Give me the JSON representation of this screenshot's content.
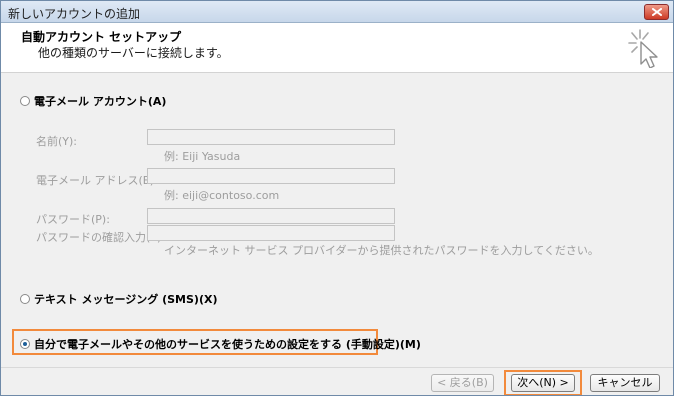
{
  "window": {
    "title": "新しいアカウントの追加"
  },
  "header": {
    "title": "自動アカウント セットアップ",
    "subtitle": "他の種類のサーバーに接続します。"
  },
  "options": {
    "email_account": "電子メール アカウント(A)",
    "sms": "テキスト メッセージング (SMS)(X)",
    "manual": "自分で電子メールやその他のサービスを使うための設定をする (手動設定)(M)",
    "selected": "manual"
  },
  "form": {
    "name_label": "名前(Y):",
    "name_example": "例: Eiji Yasuda",
    "email_label": "電子メール アドレス(E):",
    "email_example": "例: eiji@contoso.com",
    "password_label": "パスワード(P):",
    "password_confirm_label": "パスワードの確認入力(T):",
    "password_note": "インターネット サービス プロバイダーから提供されたパスワードを入力してください。"
  },
  "buttons": {
    "back": "< 戻る(B)",
    "next": "次へ(N) >",
    "cancel": "キャンセル"
  },
  "colors": {
    "highlight": "#f28a3c",
    "disabled_text": "#9d9d9d",
    "window_bg": "#f0f0f0"
  },
  "icons": {
    "title_close": "close-icon",
    "header_graphic": "cursor-sparkle-icon"
  }
}
